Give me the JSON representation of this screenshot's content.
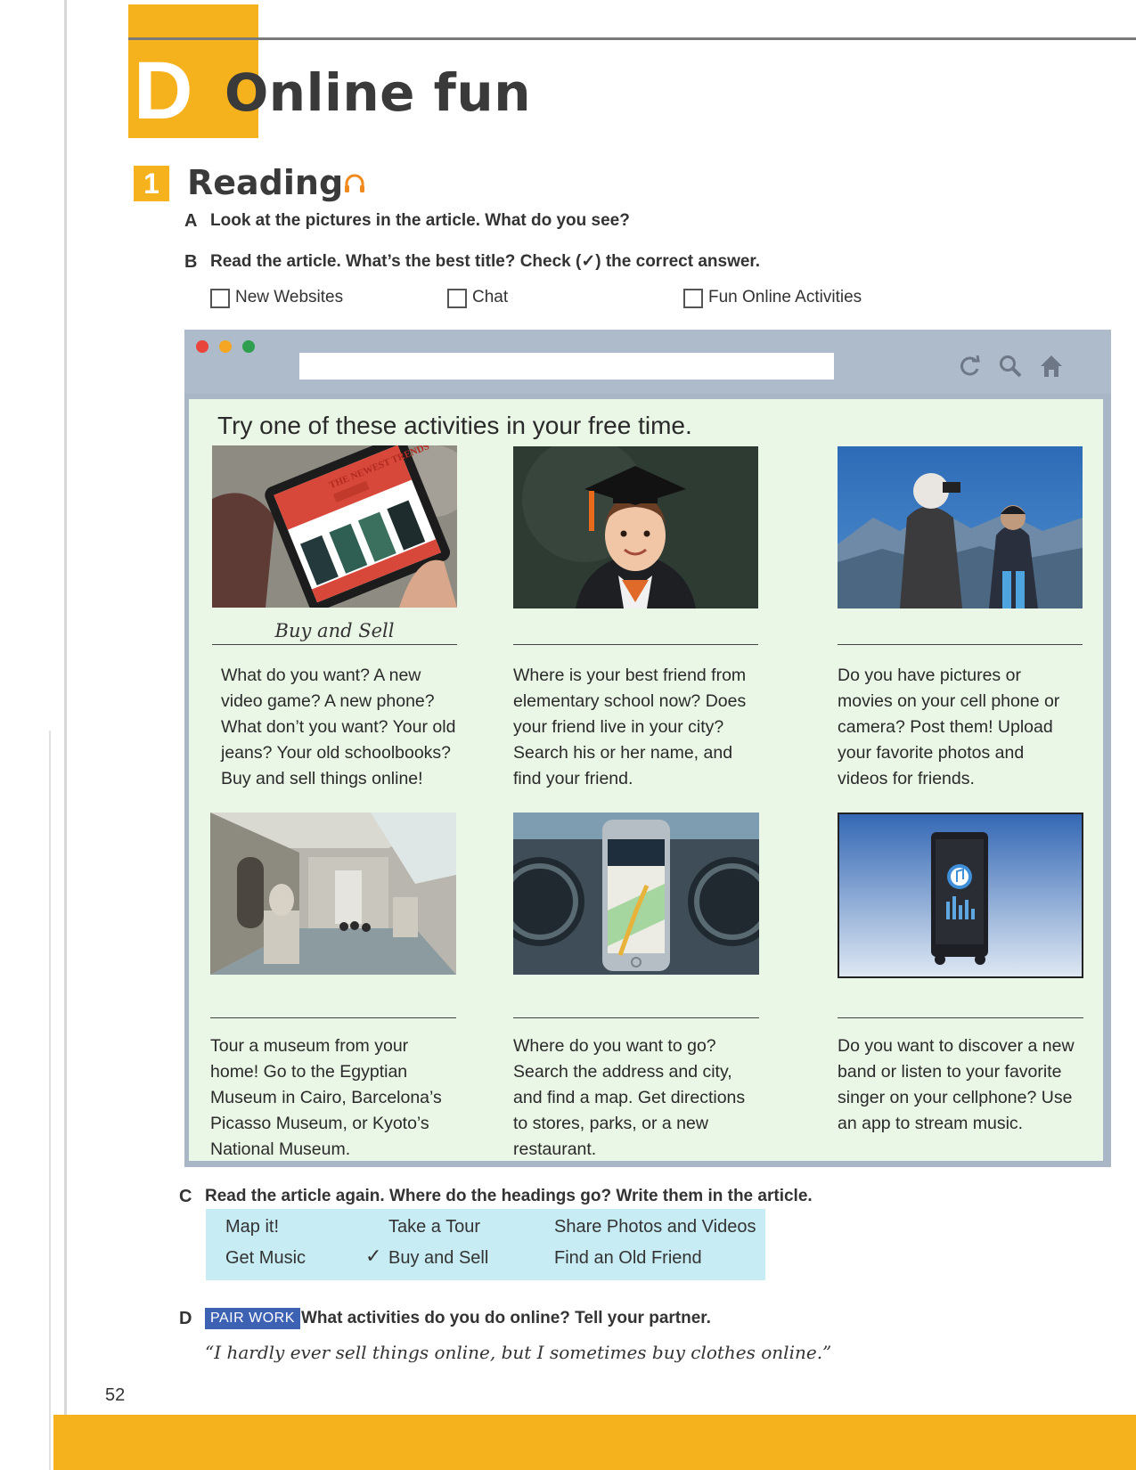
{
  "unit": {
    "letter": "D",
    "title": "Online fun"
  },
  "section": {
    "number": "1",
    "title": "Reading",
    "audio_icon": "headphones-icon"
  },
  "question_a": {
    "letter": "A",
    "text": "Look at the pictures in the article. What do you see?"
  },
  "question_b": {
    "letter": "B",
    "text": "Read the article. What’s the best title? Check (✓) the correct answer.",
    "options": [
      "New Websites",
      "Chat",
      "Fun Online Activities"
    ]
  },
  "browser": {
    "dot_colors": [
      "#e8453c",
      "#f5a623",
      "#2e9e4f"
    ],
    "icons": [
      "refresh-icon",
      "search-icon",
      "home-icon"
    ],
    "url": ""
  },
  "article": {
    "heading": "Try one of these activities in your free time.",
    "cards": [
      {
        "photo": "tablet-shopping-photo",
        "heading_label": "Buy and Sell",
        "lines": [
          "What do you want? A new",
          "video game? A new phone?",
          "What don’t you want? Your old",
          "jeans? Your old schoolbooks?",
          "Buy and sell things online!"
        ],
        "photo_caption": "THE NEWEST TRENDS"
      },
      {
        "photo": "graduate-girl-photo",
        "heading_label": "",
        "lines": [
          "Where is your best friend from",
          "elementary school now? Does",
          "your friend live in your city?",
          "Search his or her name, and",
          "find your friend."
        ]
      },
      {
        "photo": "people-taking-photos-photo",
        "heading_label": "",
        "lines": [
          "Do you have pictures or",
          "movies on your cell phone or",
          "camera? Post them! Upload",
          "your favorite photos and",
          "videos for friends."
        ]
      },
      {
        "photo": "museum-gallery-photo",
        "heading_label": "",
        "lines": [
          "Tour a museum from your",
          "home! Go to the Egyptian",
          "Museum in Cairo, Barcelona’s",
          "Picasso Museum, or Kyoto’s",
          "National Museum."
        ]
      },
      {
        "photo": "phone-map-photo",
        "heading_label": "",
        "lines": [
          "Where do you want to go?",
          "Search the address and city,",
          "and find a map. Get directions",
          "to stores, parks, or a new",
          "restaurant."
        ]
      },
      {
        "photo": "music-player-photo",
        "heading_label": "",
        "lines": [
          "Do you want to discover a new",
          "band or listen to your favorite",
          "singer on your cellphone? Use",
          "an app to stream music."
        ]
      }
    ]
  },
  "question_c": {
    "letter": "C",
    "text": "Read the article again. Where do the headings go? Write them in the article.",
    "headings": [
      {
        "text": "Map it!",
        "checked": false
      },
      {
        "text": "Take a Tour",
        "checked": false
      },
      {
        "text": "Share Photos and Videos",
        "checked": false
      },
      {
        "text": "Get Music",
        "checked": false
      },
      {
        "text": "Buy and Sell",
        "checked": true
      },
      {
        "text": "Find an Old Friend",
        "checked": false
      }
    ],
    "check_mark": "✓"
  },
  "question_d": {
    "letter": "D",
    "badge": "PAIR WORK",
    "text": "What activities do you do online? Tell your partner.",
    "quote": "“I hardly ever sell things online, but I sometimes buy clothes online.”"
  },
  "page_number": "52",
  "colors": {
    "accent": "#f6b21c",
    "browser_frame": "#a9b6c6",
    "content_bg": "#eaf6e6",
    "headings_box": "#c7ecf4",
    "badge": "#3d61b3"
  }
}
